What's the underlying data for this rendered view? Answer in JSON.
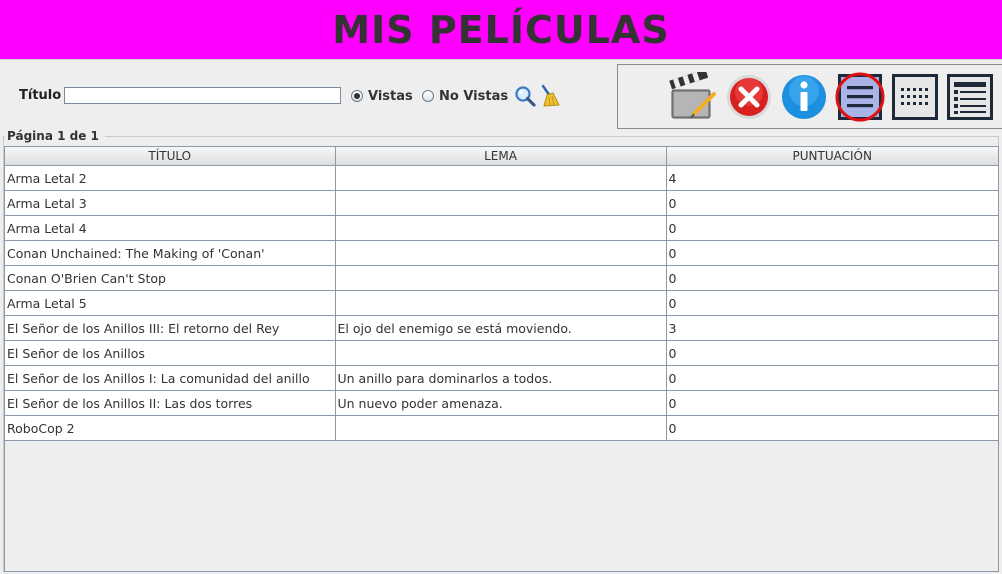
{
  "header": {
    "title": "MIS PELÍCULAS",
    "color": "#ff00ff"
  },
  "search": {
    "label": "Título",
    "value": "",
    "placeholder": "",
    "radio_watched": "Vistas",
    "radio_unwatched": "No Vistas",
    "selected": "Vistas",
    "icons": [
      "search-icon",
      "broom-clear-icon"
    ]
  },
  "toolbar": {
    "icons": [
      "clapperboard-icon",
      "delete-icon",
      "info-icon",
      "list-view-icon",
      "grid-view-icon",
      "detail-view-icon"
    ],
    "active": "list-view-icon"
  },
  "pagination": {
    "label": "Página 1 de 1"
  },
  "table": {
    "columns": [
      "TÍTULO",
      "LEMA",
      "PUNTUACIÓN"
    ],
    "rows": [
      {
        "title": "Arma Letal 2",
        "tagline": "",
        "score": "4"
      },
      {
        "title": "Arma Letal 3",
        "tagline": "",
        "score": "0"
      },
      {
        "title": "Arma Letal 4",
        "tagline": "",
        "score": "0"
      },
      {
        "title": "Conan Unchained: The Making of 'Conan'",
        "tagline": "",
        "score": "0"
      },
      {
        "title": "Conan O'Brien Can't Stop",
        "tagline": "",
        "score": "0"
      },
      {
        "title": "Arma Letal 5",
        "tagline": "",
        "score": "0"
      },
      {
        "title": "El Señor de los Anillos III: El retorno del Rey",
        "tagline": "El ojo del enemigo se está moviendo.",
        "score": "3"
      },
      {
        "title": "El Señor de los Anillos",
        "tagline": "",
        "score": "0"
      },
      {
        "title": "El Señor de los Anillos I: La comunidad del anillo",
        "tagline": "Un anillo para dominarlos a todos.",
        "score": "0"
      },
      {
        "title": "El Señor de los Anillos II: Las dos torres",
        "tagline": "Un nuevo poder amenaza.",
        "score": "0"
      },
      {
        "title": "RoboCop 2",
        "tagline": "",
        "score": "0"
      }
    ]
  }
}
